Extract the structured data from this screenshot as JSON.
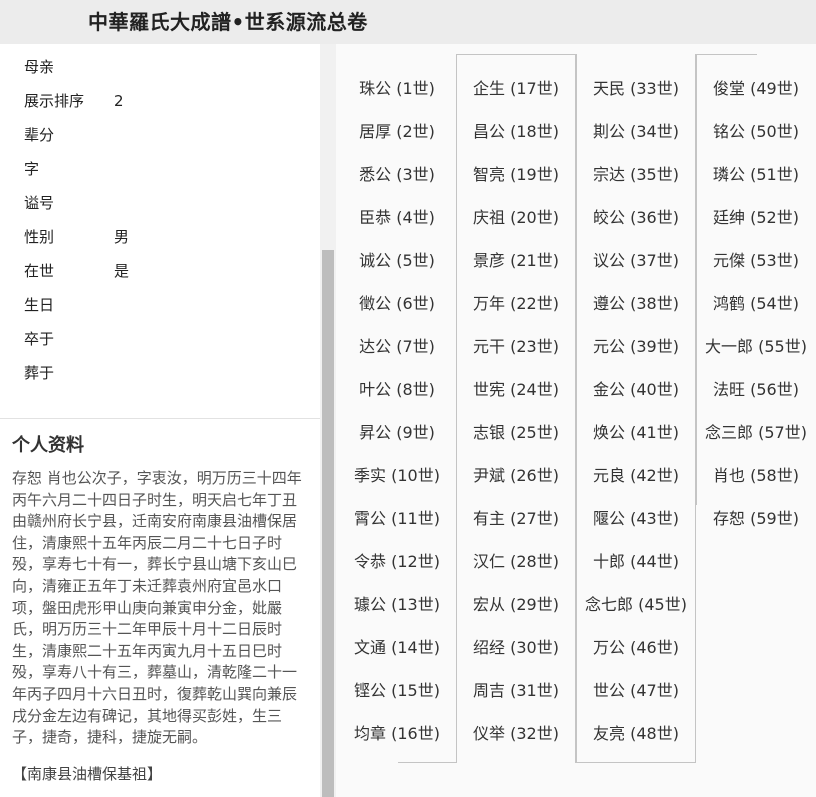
{
  "header": {
    "title": "中華羅氏大成譜•世系源流总卷"
  },
  "fields": [
    {
      "label": "母亲",
      "value": ""
    },
    {
      "label": "展示排序",
      "value": "2"
    },
    {
      "label": "辈分",
      "value": ""
    },
    {
      "label": "字",
      "value": ""
    },
    {
      "label": "谥号",
      "value": ""
    },
    {
      "label": "性别",
      "value": "男"
    },
    {
      "label": "在世",
      "value": "是"
    },
    {
      "label": "生日",
      "value": ""
    },
    {
      "label": "卒于",
      "value": ""
    },
    {
      "label": "葬于",
      "value": ""
    }
  ],
  "profile": {
    "heading": "个人资料",
    "bio": "存恕 肖也公次子，字衷汝，明万历三十四年丙午六月二十四日子时生，明天启七年丁丑由赣州府长宁县，迁南安府南康县油槽保居住，清康熙十五年丙辰二月二十七日子时殁，享寿七十有一，葬长宁县山塘下亥山巳向，清雍正五年丁未迁葬袁州府宜邑水口项，盤田虎形甲山庚向兼寅申分金，妣嚴氏，明万历三十二年甲辰十月十二日辰时生，清康熙二十五年丙寅九月十五日巳时殁，享寿八十有三，葬墓山，清乾隆二十一年丙子四月十六日丑时，復葬乾山巽向兼辰戌分金左边有碑记，其地得买彭姓，生三子，捷奇，捷科，捷旋无嗣。",
    "tag": "【南康县油槽保基祖】"
  },
  "lineage": {
    "columns": [
      [
        "珠公 (1世)",
        "居厚 (2世)",
        "悉公 (3世)",
        "臣恭 (4世)",
        "诚公 (5世)",
        "徵公 (6世)",
        "达公 (7世)",
        "叶公 (8世)",
        "昇公 (9世)",
        "季实 (10世)",
        "霄公 (11世)",
        "令恭 (12世)",
        "璩公 (13世)",
        "文通 (14世)",
        "铿公 (15世)",
        "均章 (16世)"
      ],
      [
        "企生 (17世)",
        "昌公 (18世)",
        "智亮 (19世)",
        "庆祖 (20世)",
        "景彦 (21世)",
        "万年 (22世)",
        "元干 (23世)",
        "世宪 (24世)",
        "志银 (25世)",
        "尹斌 (26世)",
        "有主 (27世)",
        "汉仁 (28世)",
        "宏从 (29世)",
        "绍经 (30世)",
        "周吉 (31世)",
        "仪举 (32世)"
      ],
      [
        "天民 (33世)",
        "剘公 (34世)",
        "宗达 (35世)",
        "皎公 (36世)",
        "议公 (37世)",
        "遵公 (38世)",
        "元公 (39世)",
        "金公 (40世)",
        "焕公 (41世)",
        "元良 (42世)",
        "隁公 (43世)",
        "十郎 (44世)",
        "念七郎 (45世)",
        "万公 (46世)",
        "世公 (47世)",
        "友亮 (48世)"
      ],
      [
        "俊堂 (49世)",
        "铭公 (50世)",
        "璘公 (51世)",
        "廷绅 (52世)",
        "元傑 (53世)",
        "鸿鹤 (54世)",
        "大一郎 (55世)",
        "法旺 (56世)",
        "念三郎 (57世)",
        "肖也 (58世)",
        "存恕 (59世)"
      ]
    ]
  }
}
